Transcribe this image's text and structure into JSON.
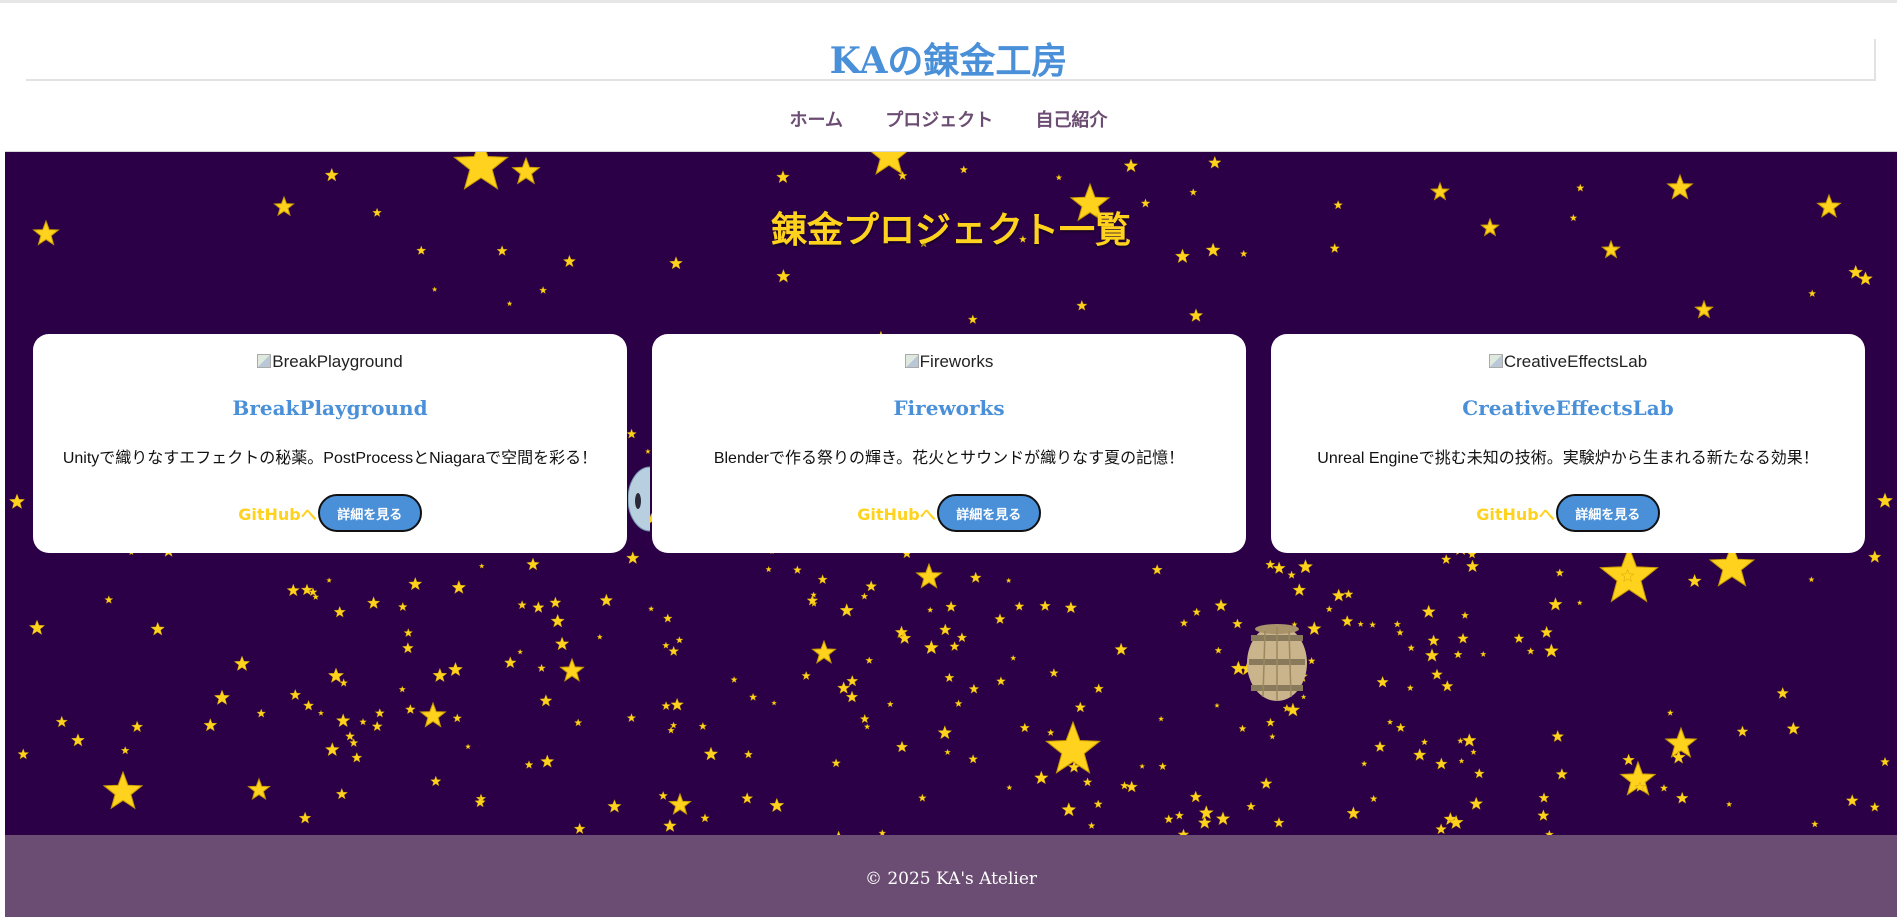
{
  "site": {
    "title": "KAの錬金工房",
    "nav": [
      "ホーム",
      "プロジェクト",
      "自己紹介"
    ]
  },
  "hero": {
    "section_title": "錬金プロジェクト一覧"
  },
  "projects": [
    {
      "image_alt": "BreakPlayground",
      "title": "BreakPlayground",
      "description": "Unityで織りなすエフェクトの秘薬。PostProcessとNiagaraで空間を彩る！",
      "github_label": "GitHubへ",
      "detail_label": "詳細を見る"
    },
    {
      "image_alt": "Fireworks",
      "title": "Fireworks",
      "description": "Blenderで作る祭りの輝き。花火とサウンドが織りなす夏の記憶！",
      "github_label": "GitHubへ",
      "detail_label": "詳細を見る"
    },
    {
      "image_alt": "CreativeEffectsLab",
      "title": "CreativeEffectsLab",
      "description": "Unreal Engineで挑む未知の技術。実験炉から生まれる新たなる効果！",
      "github_label": "GitHubへ",
      "detail_label": "詳細を見る"
    }
  ],
  "footer": {
    "copyright": "© 2025 KA's Atelier"
  },
  "colors": {
    "title_blue": "#4a90d9",
    "nav_purple": "#6b4c72",
    "hero_bg": "#2b0047",
    "star_gold": "#ffd21e",
    "footer_bg": "#6b4c72"
  },
  "icons": [
    "star-icon",
    "barrel-icon",
    "broken-image-icon"
  ]
}
